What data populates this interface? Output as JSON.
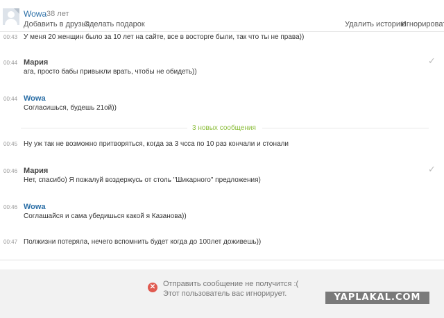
{
  "header": {
    "user_name": "Wowa",
    "user_age": "38 лет",
    "add_friend": "Добавить в друзья",
    "gift": "Сделать подарок",
    "delete_history": "Удалить историю",
    "ignore": "Игнорировать"
  },
  "messages": [
    {
      "time": "00:43",
      "author": "",
      "text": "У меня 20 женщин было за 10 лет на сайте, все в восторге были, так что ты не права))"
    },
    {
      "time": "00:44",
      "author": "Мария",
      "text": "ага, просто бабы привыкли врать, чтобы не обидеть))",
      "read": true
    },
    {
      "time": "00:44",
      "author": "Wowa",
      "text": "Согласишься, будешь 21ой))"
    },
    {
      "time": "00:45",
      "author": "",
      "text": "Ну уж так не возможно притворяться, когда за 3 чсса по 10 раз кончали и стонали"
    },
    {
      "time": "00:46",
      "author": "Мария",
      "text": "Нет, спасибо) Я пожалуй воздержусь от столь \"Шикарного\" предложения)",
      "read": true
    },
    {
      "time": "00:46",
      "author": "Wowa",
      "text": "Соглашайся и сама убедишься какой я Казанова))"
    },
    {
      "time": "00:47",
      "author": "",
      "text": "Полжизни потеряла, нечего вспомнить будет когда до 100лет доживешь))"
    }
  ],
  "new_messages_divider": "3 новых сообщения",
  "footer": {
    "error_icon": "x-circle-icon",
    "error_line1": "Отправить сообщение не получится :(",
    "error_line2": "Этот пользователь вас игнорирует."
  },
  "watermark": "YAPLAKAL.COM",
  "colors": {
    "author_link": "#2a6ea6",
    "divider_text": "#8bbd3b",
    "error_red": "#e05a50"
  }
}
